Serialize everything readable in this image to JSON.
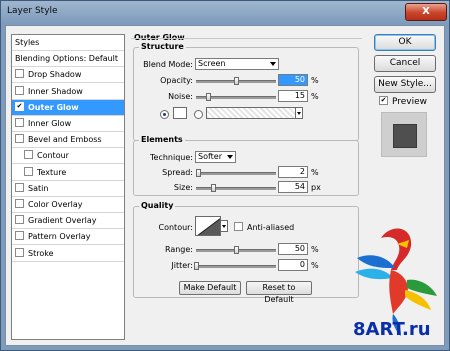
{
  "window": {
    "title": "Layer Style",
    "close_glyph": "X"
  },
  "sidebar": {
    "items": [
      {
        "label": "Styles",
        "checkbox": false,
        "checked": false,
        "selected": false,
        "indent": 0
      },
      {
        "label": "Blending Options: Default",
        "checkbox": false,
        "checked": false,
        "selected": false,
        "indent": 0
      },
      {
        "label": "Drop Shadow",
        "checkbox": true,
        "checked": false,
        "selected": false,
        "indent": 0
      },
      {
        "label": "Inner Shadow",
        "checkbox": true,
        "checked": false,
        "selected": false,
        "indent": 0
      },
      {
        "label": "Outer Glow",
        "checkbox": true,
        "checked": true,
        "selected": true,
        "indent": 0
      },
      {
        "label": "Inner Glow",
        "checkbox": true,
        "checked": false,
        "selected": false,
        "indent": 0
      },
      {
        "label": "Bevel and Emboss",
        "checkbox": true,
        "checked": false,
        "selected": false,
        "indent": 0
      },
      {
        "label": "Contour",
        "checkbox": true,
        "checked": false,
        "selected": false,
        "indent": 1
      },
      {
        "label": "Texture",
        "checkbox": true,
        "checked": false,
        "selected": false,
        "indent": 1
      },
      {
        "label": "Satin",
        "checkbox": true,
        "checked": false,
        "selected": false,
        "indent": 0
      },
      {
        "label": "Color Overlay",
        "checkbox": true,
        "checked": false,
        "selected": false,
        "indent": 0
      },
      {
        "label": "Gradient Overlay",
        "checkbox": true,
        "checked": false,
        "selected": false,
        "indent": 0
      },
      {
        "label": "Pattern Overlay",
        "checkbox": true,
        "checked": false,
        "selected": false,
        "indent": 0
      },
      {
        "label": "Stroke",
        "checkbox": true,
        "checked": false,
        "selected": false,
        "indent": 0
      }
    ]
  },
  "panel": {
    "title": "Outer Glow",
    "structure": {
      "title": "Structure",
      "blend_mode_label": "Blend Mode:",
      "blend_mode_value": "Screen",
      "opacity_label": "Opacity:",
      "opacity_value": "50",
      "opacity_unit": "%",
      "opacity_level": 0.5,
      "noise_label": "Noise:",
      "noise_value": "15",
      "noise_unit": "%",
      "noise_level": 0.15,
      "color_mode": "solid"
    },
    "elements": {
      "title": "Elements",
      "technique_label": "Technique:",
      "technique_value": "Softer",
      "spread_label": "Spread:",
      "spread_value": "2",
      "spread_unit": "%",
      "spread_level": 0.02,
      "size_label": "Size:",
      "size_value": "54",
      "size_unit": "px",
      "size_level": 0.215
    },
    "quality": {
      "title": "Quality",
      "contour_label": "Contour:",
      "anti_aliased_label": "Anti-aliased",
      "anti_aliased_checked": false,
      "range_label": "Range:",
      "range_value": "50",
      "range_unit": "%",
      "range_level": 0.5,
      "jitter_label": "Jitter:",
      "jitter_value": "0",
      "jitter_unit": "%",
      "jitter_level": 0
    },
    "make_default_label": "Make Default",
    "reset_default_label": "Reset to Default"
  },
  "actions": {
    "ok_label": "OK",
    "cancel_label": "Cancel",
    "new_style_label": "New Style...",
    "preview_label": "Preview",
    "preview_checked": true
  },
  "watermark": {
    "text": "8ART.ru"
  },
  "colors": {
    "selection": "#3399ff",
    "title_bar": "#7f9cbd",
    "close_button": "#c8452a"
  }
}
